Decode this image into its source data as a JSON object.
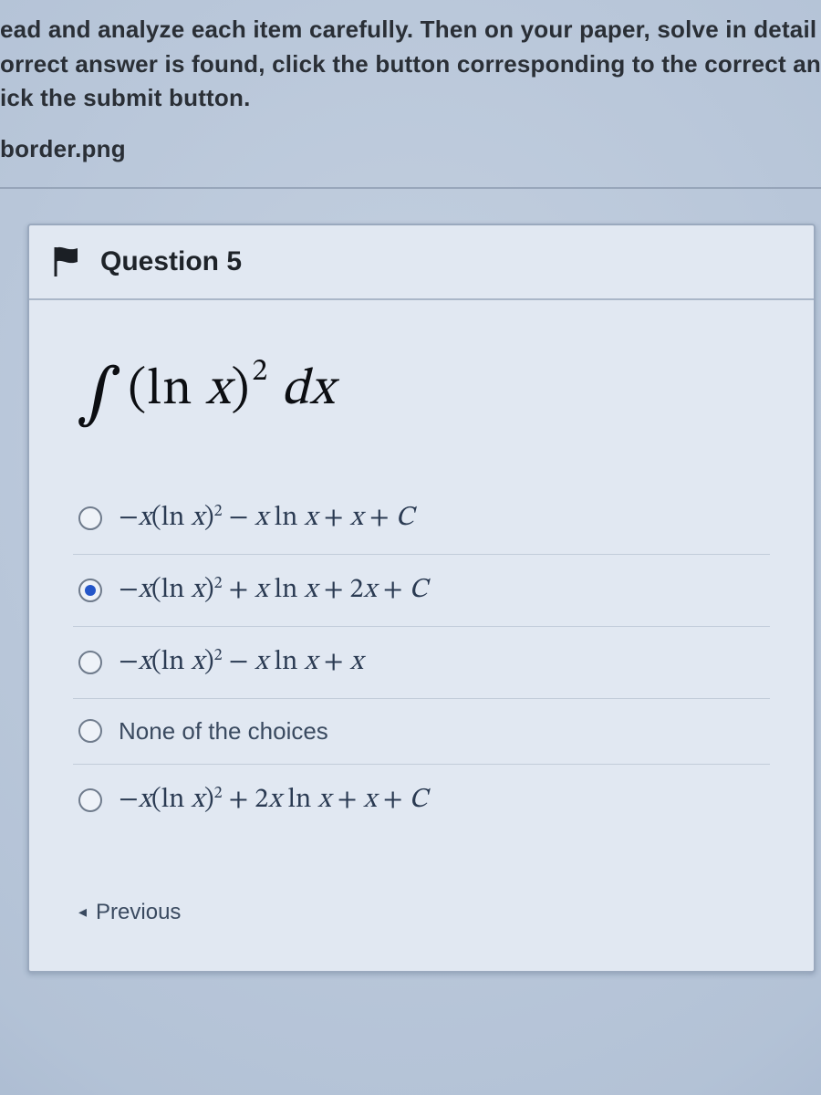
{
  "instructions": {
    "line1": "ead and analyze each item carefully. Then on your paper, solve in detail",
    "line2": "orrect answer is found, click the button corresponding to the correct an",
    "line3": "ick the submit button.",
    "image_name": "border.png"
  },
  "question": {
    "title": "Question 5",
    "prompt_html": "∫(ln x)² dx"
  },
  "options": [
    {
      "id": "a",
      "selected": false,
      "text": "−x(ln x)² − x ln x + x + C"
    },
    {
      "id": "b",
      "selected": true,
      "text": "−x(ln x)² + x ln x + 2x + C"
    },
    {
      "id": "c",
      "selected": false,
      "text": "−x(ln x)² − x ln x + x"
    },
    {
      "id": "d",
      "selected": false,
      "text": "None of the choices",
      "plain": true
    },
    {
      "id": "e",
      "selected": false,
      "text": "−x(ln x)² + 2x ln x + x + C"
    }
  ],
  "nav": {
    "previous": "Previous"
  }
}
